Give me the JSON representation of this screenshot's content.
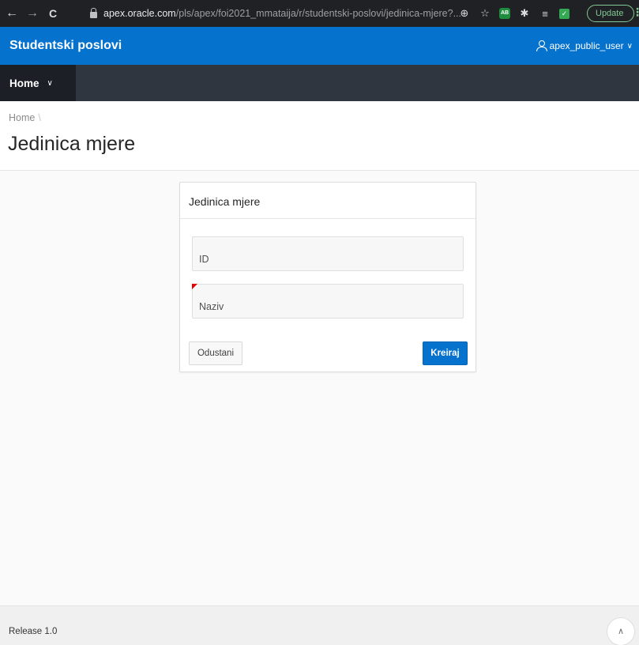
{
  "browser": {
    "back": "←",
    "forward": "→",
    "reload": "C",
    "url_domain": "apex.oracle.com",
    "url_path": "/pls/apex/foi2021_mmataija/r/studentski-poslovi/jedinica-mjere?...",
    "zoom_glyph": "⊕",
    "star_glyph": "☆",
    "ext_green": "AB",
    "puzzle_glyph": "✱",
    "queue_glyph": "≡",
    "check_glyph": "✓",
    "update_label": "Update",
    "menu_glyph": "⋮"
  },
  "header": {
    "app_title": "Studentski poslovi",
    "user_name": "apex_public_user",
    "chevron": "∨"
  },
  "nav": {
    "home_label": "Home",
    "chevron": "∨"
  },
  "title_region": {
    "breadcrumb_home": "Home",
    "breadcrumb_sep": "\\",
    "page_title": "Jedinica mjere"
  },
  "form": {
    "card_title": "Jedinica mjere",
    "id_placeholder": "ID",
    "naziv_placeholder": "Naziv",
    "cancel_label": "Odustani",
    "create_label": "Kreiraj"
  },
  "footer": {
    "release": "Release 1.0",
    "top_glyph": "∧"
  },
  "colors": {
    "brand": "#0572ce",
    "nav_bg": "#303640",
    "required": "#e00000"
  }
}
